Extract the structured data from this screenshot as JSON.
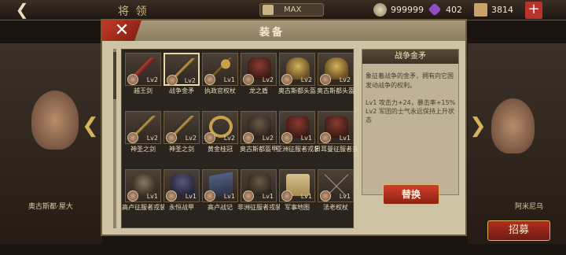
{
  "topbar": {
    "back_icon": "back-arrow-icon",
    "title": "将 领",
    "max_label": "MAX",
    "silver": "999999",
    "gems": "402",
    "gold": "3814",
    "plus_label": "+"
  },
  "modal": {
    "title": "装备",
    "close_label": "✕"
  },
  "items": [
    {
      "name": "越王剑",
      "level": "Lv2",
      "art": "sword-red"
    },
    {
      "name": "战争金矛",
      "level": "Lv2",
      "art": "spear",
      "selected": true
    },
    {
      "name": "执政官权杖",
      "level": "Lv1",
      "art": "scepter"
    },
    {
      "name": "龙之盾",
      "level": "Lv2",
      "art": "armor-red"
    },
    {
      "name": "奥古斯都头盔",
      "level": "Lv2",
      "art": "helmet"
    },
    {
      "name": "奥古斯都头盔",
      "level": "Lv2",
      "art": "helmet"
    },
    {
      "name": "神圣之剑",
      "level": "Lv2",
      "art": "spear"
    },
    {
      "name": "神圣之剑",
      "level": "Lv2",
      "art": "spear"
    },
    {
      "name": "黄金桂冠",
      "level": "Lv2",
      "art": "ring"
    },
    {
      "name": "奥古斯都盔甲",
      "level": "Lv2",
      "art": "armor"
    },
    {
      "name": "亚洲征服者戎装",
      "level": "Lv1",
      "art": "armor-red"
    },
    {
      "name": "日耳曼征服者戎装",
      "level": "Lv1",
      "art": "armor-red"
    },
    {
      "name": "高卢征服者戎装",
      "level": "Lv1",
      "art": "helmet-dark"
    },
    {
      "name": "永恒战甲",
      "level": "Lv1",
      "art": "armor-blue"
    },
    {
      "name": "高卢战记",
      "level": "Lv1",
      "art": "book"
    },
    {
      "name": "非洲征服者戎装",
      "level": "Lv1",
      "art": "armor"
    },
    {
      "name": "军事地图",
      "level": "Lv1",
      "art": "scroll"
    },
    {
      "name": "法老权杖",
      "level": "Lv1",
      "art": "crossed"
    }
  ],
  "detail": {
    "title": "战争金矛",
    "description": "象征着战争的金矛，拥有向它国发动战争的权利。",
    "stat_lines": [
      "Lv1  攻击力+24，暴击率+15%",
      "Lv2  军团的士气永远保持上升状态"
    ],
    "swap_label": "替换"
  },
  "scene": {
    "recruit_label": "招募",
    "left_name": "奥古斯都·屋大",
    "right_name": "阿米尼乌"
  }
}
